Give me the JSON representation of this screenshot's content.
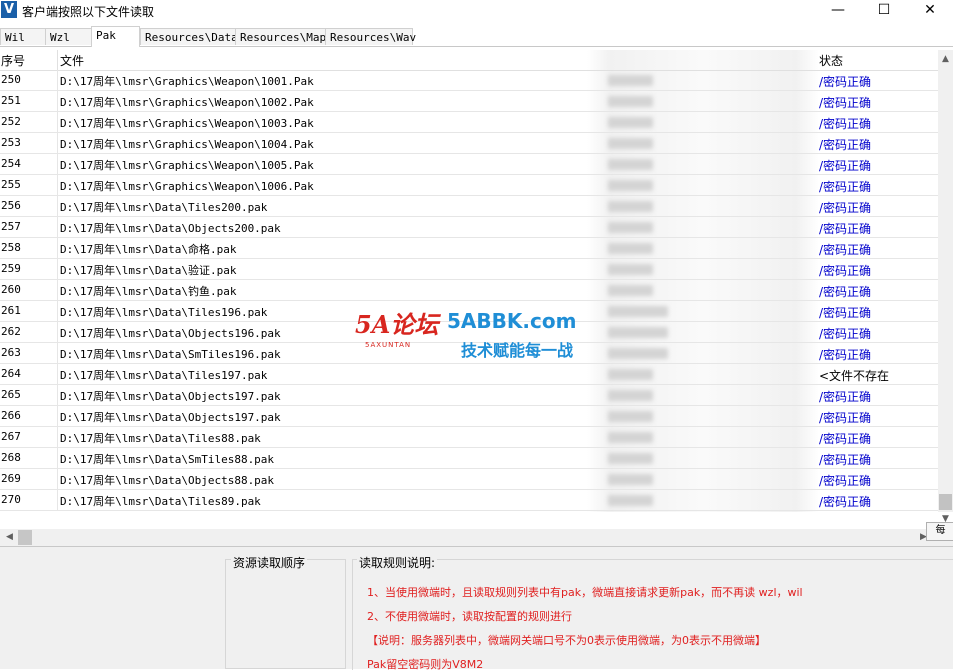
{
  "window": {
    "title": "客户端按照以下文件读取",
    "icon_letter": "V",
    "minimize": "—",
    "maximize": "☐",
    "close": "✕"
  },
  "tabs": [
    {
      "label": "Wil",
      "active": false
    },
    {
      "label": "Wzl",
      "active": false
    },
    {
      "label": "Pak",
      "active": true
    },
    {
      "label": "Resources\\Data",
      "active": false
    },
    {
      "label": "Resources\\Map",
      "active": false
    },
    {
      "label": "Resources\\Wav",
      "active": false
    }
  ],
  "grid": {
    "columns": {
      "no": "序号",
      "file": "文件",
      "status": "状态"
    },
    "rows": [
      {
        "no": "250",
        "file": "D:\\17周年\\lmsr\\Graphics\\Weapon\\1001.Pak",
        "status": "/密码正确",
        "ok": true
      },
      {
        "no": "251",
        "file": "D:\\17周年\\lmsr\\Graphics\\Weapon\\1002.Pak",
        "status": "/密码正确",
        "ok": true
      },
      {
        "no": "252",
        "file": "D:\\17周年\\lmsr\\Graphics\\Weapon\\1003.Pak",
        "status": "/密码正确",
        "ok": true
      },
      {
        "no": "253",
        "file": "D:\\17周年\\lmsr\\Graphics\\Weapon\\1004.Pak",
        "status": "/密码正确",
        "ok": true
      },
      {
        "no": "254",
        "file": "D:\\17周年\\lmsr\\Graphics\\Weapon\\1005.Pak",
        "status": "/密码正确",
        "ok": true
      },
      {
        "no": "255",
        "file": "D:\\17周年\\lmsr\\Graphics\\Weapon\\1006.Pak",
        "status": "/密码正确",
        "ok": true
      },
      {
        "no": "256",
        "file": "D:\\17周年\\lmsr\\Data\\Tiles200.pak",
        "status": "/密码正确",
        "ok": true
      },
      {
        "no": "257",
        "file": "D:\\17周年\\lmsr\\Data\\Objects200.pak",
        "status": "/密码正确",
        "ok": true
      },
      {
        "no": "258",
        "file": "D:\\17周年\\lmsr\\Data\\命格.pak",
        "status": "/密码正确",
        "ok": true
      },
      {
        "no": "259",
        "file": "D:\\17周年\\lmsr\\Data\\验证.pak",
        "status": "/密码正确",
        "ok": true
      },
      {
        "no": "260",
        "file": "D:\\17周年\\lmsr\\Data\\钓鱼.pak",
        "status": "/密码正确",
        "ok": true
      },
      {
        "no": "261",
        "file": "D:\\17周年\\lmsr\\Data\\Tiles196.pak",
        "status": "/密码正确",
        "ok": true
      },
      {
        "no": "262",
        "file": "D:\\17周年\\lmsr\\Data\\Objects196.pak",
        "status": "/密码正确",
        "ok": true
      },
      {
        "no": "263",
        "file": "D:\\17周年\\lmsr\\Data\\SmTiles196.pak",
        "status": "/密码正确",
        "ok": true
      },
      {
        "no": "264",
        "file": "D:\\17周年\\lmsr\\Data\\Tiles197.pak",
        "status": "<文件不存在",
        "ok": false
      },
      {
        "no": "265",
        "file": "D:\\17周年\\lmsr\\Data\\Objects197.pak",
        "status": "/密码正确",
        "ok": true
      },
      {
        "no": "266",
        "file": "D:\\17周年\\lmsr\\Data\\Objects197.pak",
        "status": "/密码正确",
        "ok": true
      },
      {
        "no": "267",
        "file": "D:\\17周年\\lmsr\\Data\\Tiles88.pak",
        "status": "/密码正确",
        "ok": true
      },
      {
        "no": "268",
        "file": "D:\\17周年\\lmsr\\Data\\SmTiles88.pak",
        "status": "/密码正确",
        "ok": true
      },
      {
        "no": "269",
        "file": "D:\\17周年\\lmsr\\Data\\Objects88.pak",
        "status": "/密码正确",
        "ok": true
      },
      {
        "no": "270",
        "file": "D:\\17周年\\lmsr\\Data\\Tiles89.pak",
        "status": "/密码正确",
        "ok": true
      }
    ]
  },
  "tooltip": "每",
  "watermark": {
    "logo": "5A论坛",
    "logo_sub": "5AXUNTAN",
    "site": "5ABBK.com",
    "slogan": "技术赋能每一战"
  },
  "bottom": {
    "left_title": "资源读取顺序",
    "rules_title": "读取规则说明:",
    "rules": [
      "1、当使用微端时，且读取规则列表中有pak，微端直接请求更新pak，而不再读 wzl，wil",
      "2、不使用微端时，读取按配置的规则进行",
      "【说明：服务器列表中，微端网关端口号不为0表示使用微端，为0表示不用微端】",
      "Pak留空密码则为V8M2"
    ]
  },
  "colors": {
    "status_ok": "#0000cc",
    "status_missing": "#000000",
    "rule_text": "#e02020",
    "watermark_red": "#d8261f",
    "watermark_blue": "#1f8ed6"
  }
}
